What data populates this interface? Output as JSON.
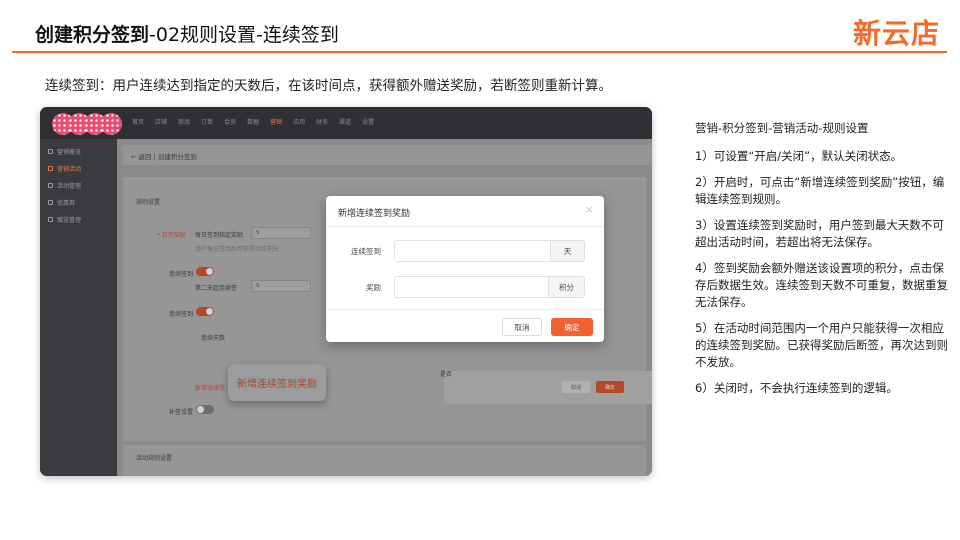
{
  "header": {
    "title_bold": "创建积分签到",
    "title_rest": "-02规则设置-连续签到",
    "brand": "新云店"
  },
  "intro": "连续签到：用户连续达到指定的天数后，在该时间点，获得额外赠送奖励，若断签则重新计算。",
  "app": {
    "top_nav": [
      "首页",
      "店铺",
      "商品",
      "订单",
      "会员",
      "数据",
      "营销",
      "应用",
      "财务",
      "渠道",
      "设置"
    ],
    "top_nav_active": "营销",
    "sidebar": [
      {
        "label": "营销概览",
        "active": false
      },
      {
        "label": "营销活动",
        "active": true
      },
      {
        "label": "活动管理",
        "active": false
      },
      {
        "label": "优惠券",
        "active": false
      },
      {
        "label": "赠送管理",
        "active": false
      }
    ],
    "breadcrumb": "← 返回  |  创建积分签到",
    "section_rules": "规则设置",
    "field_daily": "* 日签奖励",
    "daily_text": "每日签到指定奖励",
    "daily_value": "5",
    "daily_hint": "用户每日签到后可获得对应积分",
    "field_continuous": "连续签到",
    "second_day_text": "第二天起连续签",
    "second_day_value": "5",
    "field_continuous2": "连续签到",
    "continuous_days_text": "连续天数",
    "add_link": "新增连续签",
    "field_extra": "补签设置",
    "partial_label": "是否",
    "section_activity": "活动规则设置",
    "callout": "新增连续签到奖励",
    "back_dialog": {
      "cancel": "取消",
      "ok": "确定"
    }
  },
  "modal": {
    "title": "新增连续签到奖励",
    "close": "×",
    "field1_label": "连续签到",
    "field1_value": "",
    "field1_suffix": "天",
    "field2_label": "奖励",
    "field2_value": "",
    "field2_suffix": "积分",
    "cancel": "取消",
    "ok": "确定"
  },
  "notes": [
    "营销-积分签到-营销活动-规则设置",
    "1）可设置“开启/关闭”，默认关闭状态。",
    "2）开启时，可点击“新增连续签到奖励”按钮，编辑连续签到规则。",
    "3）设置连续签到奖励时，用户签到最大天数不可超出活动时间，若超出将无法保存。",
    "4）签到奖励会额外赠送该设置项的积分，点击保存后数据生效。连续签到天数不可重复，数据重复无法保存。",
    "5）在活动时间范围内一个用户只能获得一次相应的连续签到奖励。已获得奖励后断签，再次达到则不发放。",
    "6）关闭时，不会执行连续签到的逻辑。"
  ],
  "colors": {
    "accent": "#f26b2a",
    "primary_button": "#f2602f"
  }
}
